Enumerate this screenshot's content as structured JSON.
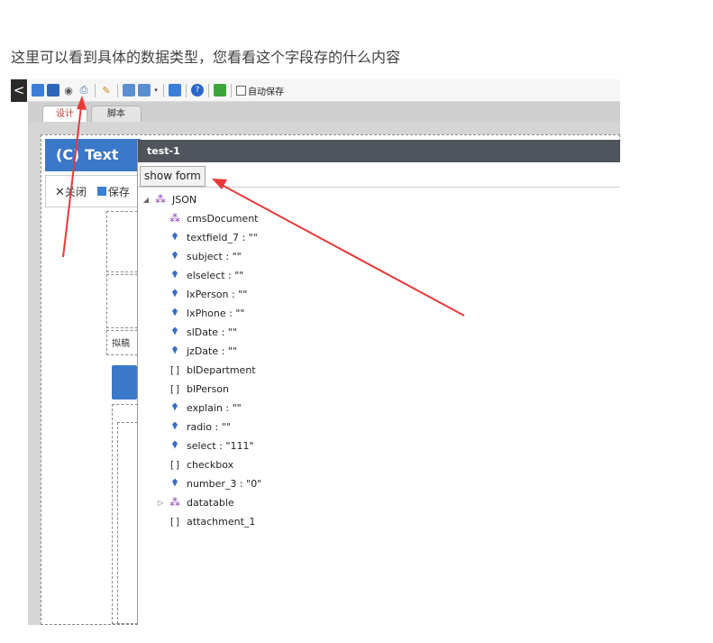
{
  "caption": "这里可以看到具体的数据类型，您看看这个字段存的什么内容",
  "toolbar": {
    "collapse_glyph": "<",
    "autosave_label": "自动保存",
    "icons": [
      "save-icon",
      "save-as-icon",
      "preview-eye-icon",
      "print-icon",
      "wand-icon",
      "import-icon",
      "export-icon",
      "dropdown-icon",
      "form-view-icon",
      "help-icon",
      "publish-icon"
    ]
  },
  "tabs": {
    "design": "设计",
    "script": "脚本"
  },
  "form": {
    "title": "(C) Text",
    "close_label": "关闭",
    "save_label": "保存",
    "draft_label": "拟稿"
  },
  "panel": {
    "title": "test-1",
    "show_form_label": "show form",
    "root": {
      "toggle": "◢",
      "label": "JSON"
    },
    "tree": [
      {
        "type": "object",
        "label": "cmsDocument"
      },
      {
        "type": "value",
        "label": "textfield_7 : \"\""
      },
      {
        "type": "value",
        "label": "subject : \"\""
      },
      {
        "type": "value",
        "label": "elselect : \"\""
      },
      {
        "type": "value",
        "label": "lxPerson : \"\""
      },
      {
        "type": "value",
        "label": "lxPhone : \"\""
      },
      {
        "type": "value",
        "label": "slDate : \"\""
      },
      {
        "type": "value",
        "label": "jzDate : \"\""
      },
      {
        "type": "array",
        "label": "blDepartment"
      },
      {
        "type": "array",
        "label": "blPerson"
      },
      {
        "type": "value",
        "label": "explain : \"\""
      },
      {
        "type": "value",
        "label": "radio : \"\""
      },
      {
        "type": "value",
        "label": "select : \"111\""
      },
      {
        "type": "array",
        "label": "checkbox"
      },
      {
        "type": "value",
        "label": "number_3 : \"0\""
      }
    ],
    "datatable": {
      "toggle": "▷",
      "label": "datatable"
    },
    "attachment": {
      "label": "attachment_1"
    }
  },
  "colors": {
    "accent": "#3a78c9",
    "arrow": "#e8393a",
    "panel_title": "#50555d"
  }
}
